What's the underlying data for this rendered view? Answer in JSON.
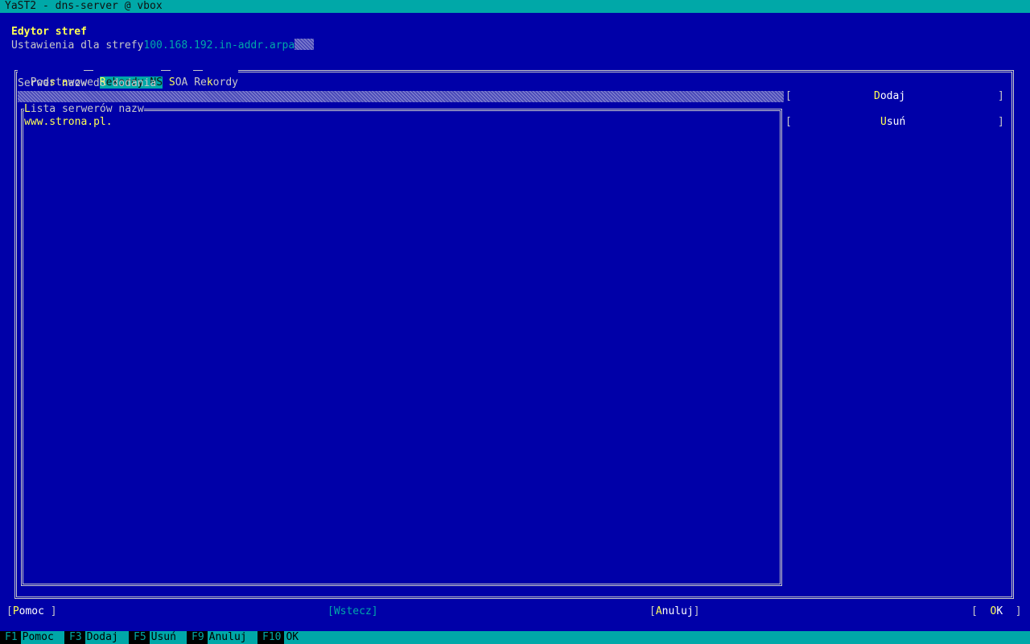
{
  "window": {
    "title": "YaST2 - dns-server @ vbox"
  },
  "header": {
    "title": "Edytor stref",
    "subtitle_prefix": "Ustawienia dla strefy",
    "zone_name": "100.168.192.in-addr.arpa"
  },
  "tabs": [
    {
      "label": "Podstawowe",
      "active": false
    },
    {
      "label": "Rekordy NS",
      "active": true
    },
    {
      "label": "SOA",
      "active": false
    },
    {
      "label": "Rekordy",
      "active": false
    }
  ],
  "form": {
    "add_label": "Serwer nazw do dodania",
    "add_input_value": "",
    "add_button": "Dodaj",
    "remove_button": "Usuń",
    "list_title": "Lista serwerów nazw",
    "list_items": [
      "www.strona.pl."
    ]
  },
  "buttons": {
    "help": "Pomoc",
    "back": "Wstecz",
    "cancel": "Anuluj",
    "ok": "OK"
  },
  "fkeys": [
    {
      "key": "F1",
      "label": "Pomoc"
    },
    {
      "key": "F3",
      "label": "Dodaj"
    },
    {
      "key": "F5",
      "label": "Usuń"
    },
    {
      "key": "F9",
      "label": "Anuluj"
    },
    {
      "key": "F10",
      "label": "OK"
    }
  ],
  "colors": {
    "background": "#0000a8",
    "accent": "#00a8a8",
    "highlight": "#ffff54",
    "text": "#c8c8c8"
  }
}
